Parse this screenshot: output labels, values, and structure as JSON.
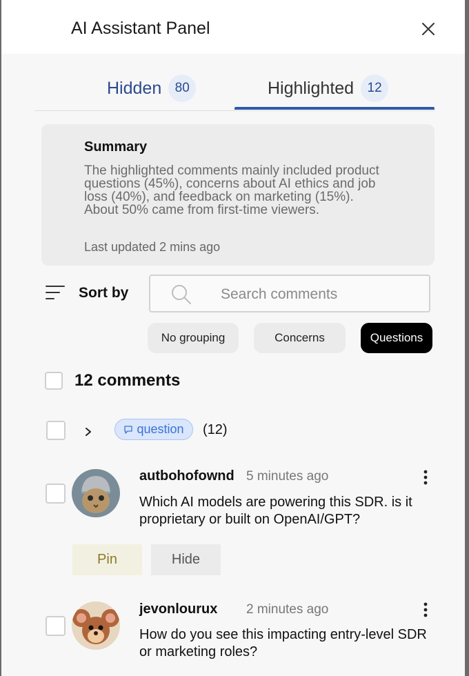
{
  "header": {
    "title": "AI Assistant Panel"
  },
  "tabs": [
    {
      "label": "Hidden",
      "count": "80"
    },
    {
      "label": "Highlighted",
      "count": "12"
    }
  ],
  "summary": {
    "title": "Summary",
    "text": "The highlighted comments mainly included product questions (45%), concerns about AI ethics and job loss (40%), and feedback on marketing (15%). About 50% came from first-time viewers.",
    "updated": "Last updated 2 mins ago"
  },
  "toolbar": {
    "sort_label": "Sort by"
  },
  "search": {
    "placeholder": "Search comments",
    "value": ""
  },
  "filters": {
    "chips": [
      "No grouping",
      "Concerns",
      "Questions"
    ],
    "selected": "Questions"
  },
  "list": {
    "count_label": "12 comments",
    "group": {
      "tag": "question",
      "count": "(12)"
    }
  },
  "comments": [
    {
      "user": "autbohofownd",
      "time": "5 minutes ago",
      "text": "Which AI models are powering this SDR. is it proprietary or built on OpenAI/GPT?"
    },
    {
      "user": "jevonlourux",
      "time": "2 minutes ago",
      "text": "How do you see this impacting entry-level SDR or marketing roles?"
    }
  ],
  "actions": {
    "pin": "Pin",
    "hide": "Hide"
  },
  "colors": {
    "accent": "#2f5aa8",
    "tag_bg": "#d9e6fb",
    "tag_text": "#3a73d6",
    "pin_bg": "#f2f0e0"
  }
}
